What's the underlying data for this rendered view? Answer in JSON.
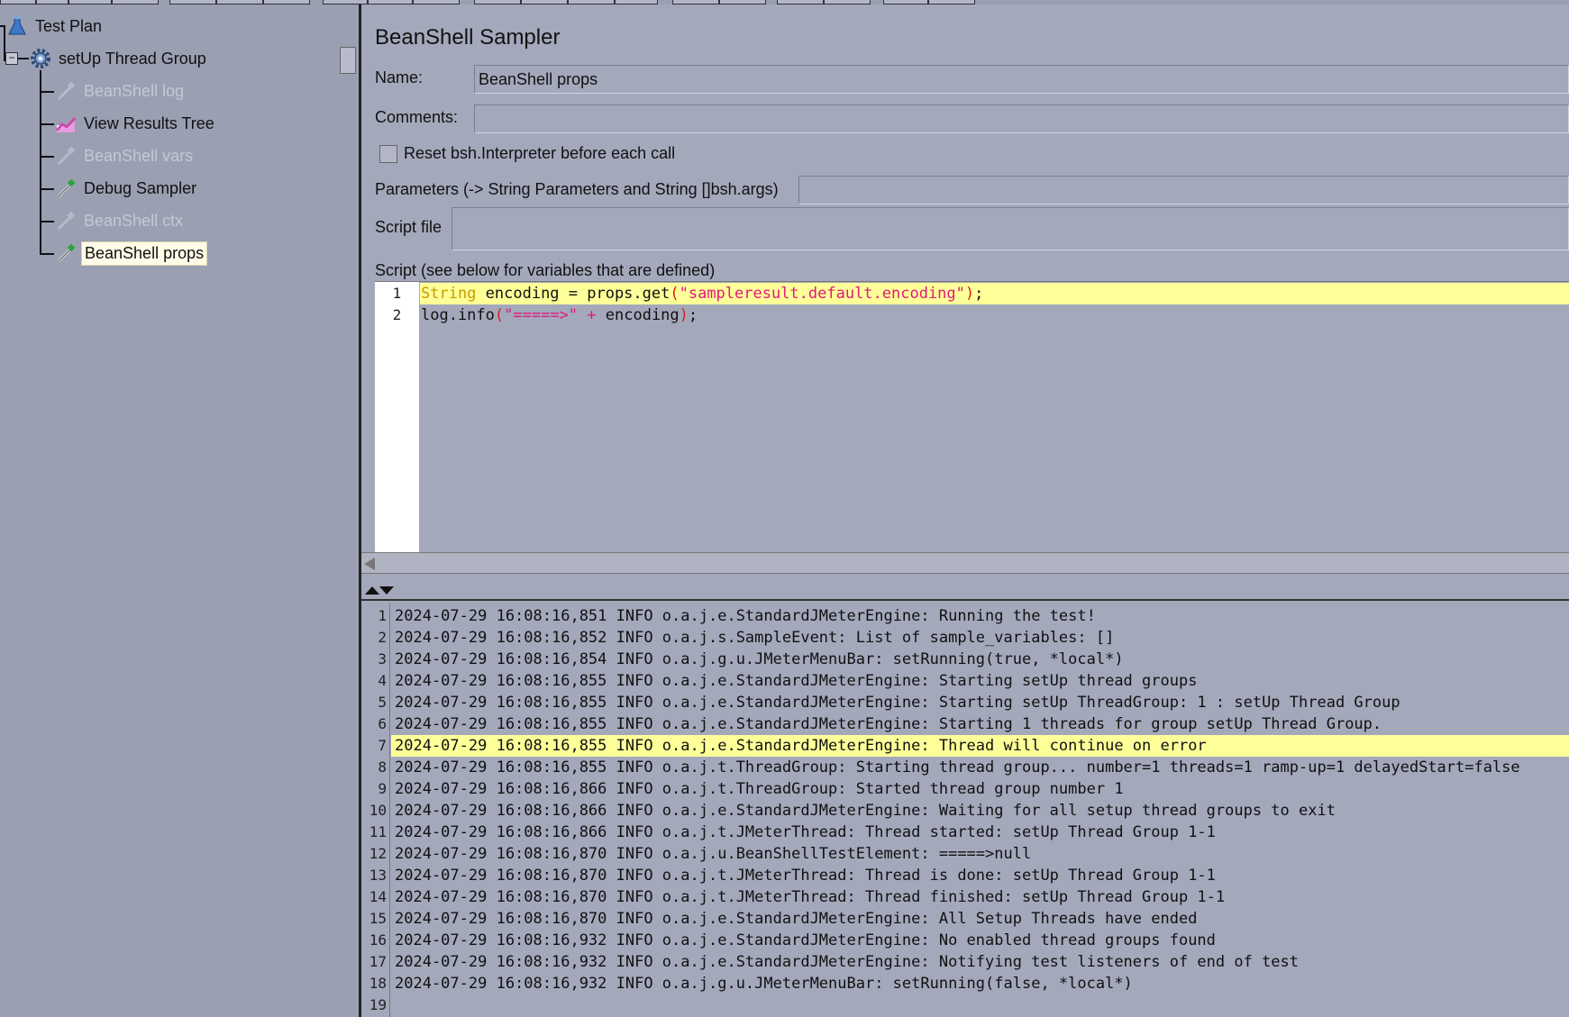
{
  "window": {
    "title": "BeanShell Sampler"
  },
  "tree": {
    "items": [
      {
        "label": "Test Plan",
        "icon": "flask-icon",
        "enabled": true,
        "selected": false
      },
      {
        "label": "setUp Thread Group",
        "icon": "gear-icon",
        "enabled": true,
        "selected": false
      },
      {
        "label": "BeanShell log",
        "icon": "pipette-icon",
        "enabled": false,
        "selected": false
      },
      {
        "label": "View Results Tree",
        "icon": "chart-icon",
        "enabled": true,
        "selected": false
      },
      {
        "label": "BeanShell vars",
        "icon": "pipette-icon",
        "enabled": false,
        "selected": false
      },
      {
        "label": "Debug Sampler",
        "icon": "pipette-icon",
        "enabled": true,
        "selected": false
      },
      {
        "label": "BeanShell ctx",
        "icon": "pipette-icon",
        "enabled": false,
        "selected": false
      },
      {
        "label": "BeanShell props",
        "icon": "pipette-icon",
        "enabled": true,
        "selected": true
      }
    ]
  },
  "form": {
    "name_label": "Name:",
    "name_value": "BeanShell props",
    "comments_label": "Comments:",
    "comments_value": "",
    "reset_label": "Reset bsh.Interpreter before each call",
    "reset_checked": false,
    "parameters_label": "Parameters (-> String Parameters and String []bsh.args)",
    "parameters_value": "",
    "script_file_label": "Script file",
    "script_file_value": "",
    "script_label": "Script (see below for variables that are defined)"
  },
  "script": {
    "lines": [
      {
        "num": "1",
        "text": "String encoding = props.get(\"sampleresult.default.encoding\");"
      },
      {
        "num": "2",
        "text": "log.info(\"=====>\" + encoding);"
      }
    ]
  },
  "log": {
    "current_line": 7,
    "lines": [
      {
        "num": "1",
        "text": "2024-07-29 16:08:16,851 INFO o.a.j.e.StandardJMeterEngine: Running the test!"
      },
      {
        "num": "2",
        "text": "2024-07-29 16:08:16,852 INFO o.a.j.s.SampleEvent: List of sample_variables: []"
      },
      {
        "num": "3",
        "text": "2024-07-29 16:08:16,854 INFO o.a.j.g.u.JMeterMenuBar: setRunning(true, *local*)"
      },
      {
        "num": "4",
        "text": "2024-07-29 16:08:16,855 INFO o.a.j.e.StandardJMeterEngine: Starting setUp thread groups"
      },
      {
        "num": "5",
        "text": "2024-07-29 16:08:16,855 INFO o.a.j.e.StandardJMeterEngine: Starting setUp ThreadGroup: 1 : setUp Thread Group"
      },
      {
        "num": "6",
        "text": "2024-07-29 16:08:16,855 INFO o.a.j.e.StandardJMeterEngine: Starting 1 threads for group setUp Thread Group."
      },
      {
        "num": "7",
        "text": "2024-07-29 16:08:16,855 INFO o.a.j.e.StandardJMeterEngine: Thread will continue on error"
      },
      {
        "num": "8",
        "text": "2024-07-29 16:08:16,855 INFO o.a.j.t.ThreadGroup: Starting thread group... number=1 threads=1 ramp-up=1 delayedStart=false"
      },
      {
        "num": "9",
        "text": "2024-07-29 16:08:16,866 INFO o.a.j.t.ThreadGroup: Started thread group number 1"
      },
      {
        "num": "10",
        "text": "2024-07-29 16:08:16,866 INFO o.a.j.e.StandardJMeterEngine: Waiting for all setup thread groups to exit"
      },
      {
        "num": "11",
        "text": "2024-07-29 16:08:16,866 INFO o.a.j.t.JMeterThread: Thread started: setUp Thread Group 1-1"
      },
      {
        "num": "12",
        "text": "2024-07-29 16:08:16,870 INFO o.a.j.u.BeanShellTestElement: =====>null"
      },
      {
        "num": "13",
        "text": "2024-07-29 16:08:16,870 INFO o.a.j.t.JMeterThread: Thread is done: setUp Thread Group 1-1"
      },
      {
        "num": "14",
        "text": "2024-07-29 16:08:16,870 INFO o.a.j.t.JMeterThread: Thread finished: setUp Thread Group 1-1"
      },
      {
        "num": "15",
        "text": "2024-07-29 16:08:16,870 INFO o.a.j.e.StandardJMeterEngine: All Setup Threads have ended"
      },
      {
        "num": "16",
        "text": "2024-07-29 16:08:16,932 INFO o.a.j.e.StandardJMeterEngine: No enabled thread groups found"
      },
      {
        "num": "17",
        "text": "2024-07-29 16:08:16,932 INFO o.a.j.e.StandardJMeterEngine: Notifying test listeners of end of test"
      },
      {
        "num": "18",
        "text": "2024-07-29 16:08:16,932 INFO o.a.j.g.u.JMeterMenuBar: setRunning(false, *local*)"
      },
      {
        "num": "19",
        "text": ""
      }
    ]
  },
  "colors": {
    "panel_bg": "#a4a8bb",
    "tree_bg": "#9a9fb2",
    "current_line": "#ffff99",
    "keyword": "#c89b00",
    "string": "#e0197d",
    "selected_bg": "#fffbe6"
  }
}
